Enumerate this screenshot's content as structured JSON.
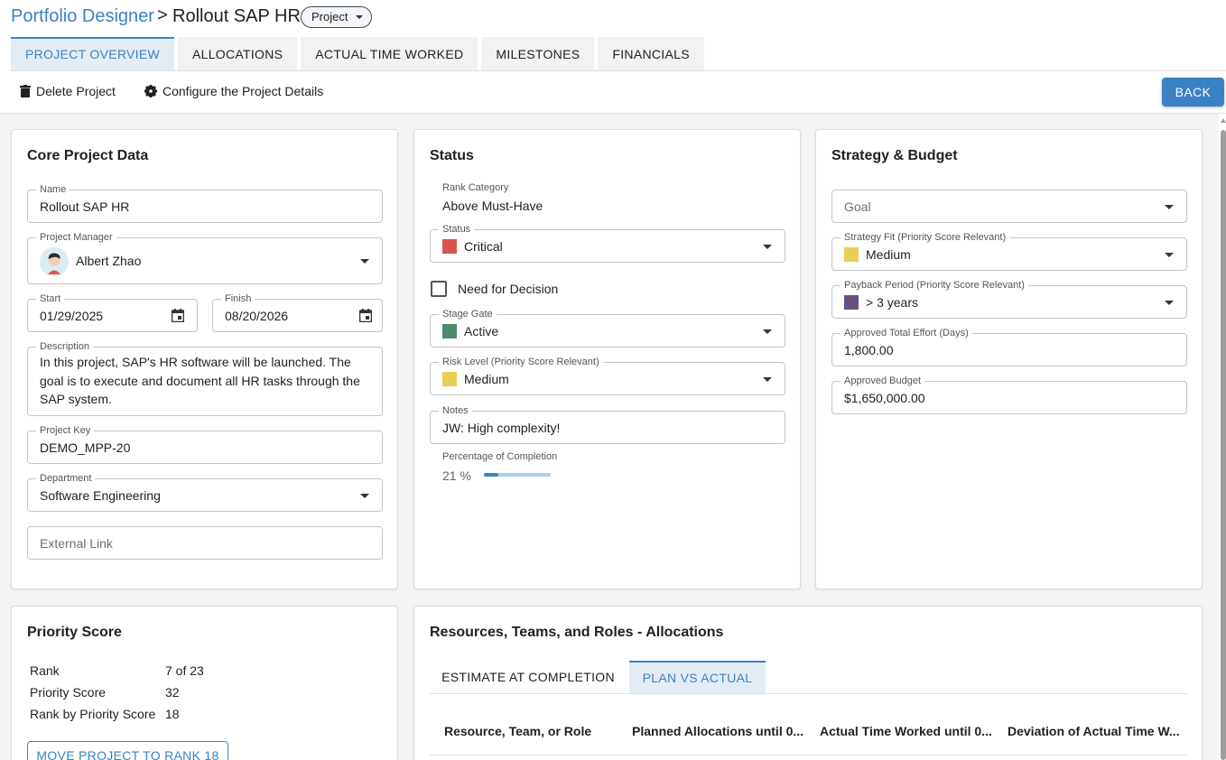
{
  "header": {
    "app_title": "Portfolio Designer",
    "separator": ">",
    "project_title": "Rollout SAP HR",
    "type_chip": "Project"
  },
  "tabs": [
    {
      "label": "PROJECT OVERVIEW",
      "active": true
    },
    {
      "label": "ALLOCATIONS",
      "active": false
    },
    {
      "label": "ACTUAL TIME WORKED",
      "active": false
    },
    {
      "label": "MILESTONES",
      "active": false
    },
    {
      "label": "FINANCIALS",
      "active": false
    }
  ],
  "toolbar": {
    "delete_label": "Delete Project",
    "configure_label": "Configure the Project Details",
    "back_label": "BACK"
  },
  "core": {
    "title": "Core Project Data",
    "name_label": "Name",
    "name_value": "Rollout SAP HR",
    "pm_label": "Project Manager",
    "pm_value": "Albert Zhao",
    "start_label": "Start",
    "start_value": "01/29/2025",
    "finish_label": "Finish",
    "finish_value": "08/20/2026",
    "description_label": "Description",
    "description_value": "In this project, SAP's HR software will be launched. The goal is to execute and document all HR tasks through the SAP system.",
    "key_label": "Project Key",
    "key_value": "DEMO_MPP-20",
    "dept_label": "Department",
    "dept_value": "Software Engineering",
    "link_placeholder": "External Link"
  },
  "status": {
    "title": "Status",
    "rank_category_label": "Rank Category",
    "rank_category_value": "Above Must-Have",
    "status_label": "Status",
    "status_value": "Critical",
    "status_color": "#d9534f",
    "need_decision_label": "Need for Decision",
    "need_decision_checked": false,
    "stage_gate_label": "Stage Gate",
    "stage_gate_value": "Active",
    "stage_gate_color": "#4e8a6e",
    "risk_label": "Risk Level (Priority Score Relevant)",
    "risk_value": "Medium",
    "risk_color": "#e8cf55",
    "notes_label": "Notes",
    "notes_value": "JW: High complexity!",
    "completion_label": "Percentage of Completion",
    "completion_text": "21 %",
    "completion_percent": 21
  },
  "strategy": {
    "title": "Strategy & Budget",
    "goal_placeholder": "Goal",
    "fit_label": "Strategy Fit (Priority Score Relevant)",
    "fit_value": "Medium",
    "fit_color": "#e8cf55",
    "payback_label": "Payback Period (Priority Score Relevant)",
    "payback_value": "> 3 years",
    "payback_color": "#6a5080",
    "effort_label": "Approved Total Effort (Days)",
    "effort_value": "1,800.00",
    "budget_label": "Approved Budget",
    "budget_value": "$1,650,000.00"
  },
  "priority": {
    "title": "Priority Score",
    "rows": [
      {
        "label": "Rank",
        "value": "7 of 23"
      },
      {
        "label": "Priority Score",
        "value": "32"
      },
      {
        "label": "Rank by Priority Score",
        "value": "18"
      }
    ],
    "move_button": "MOVE PROJECT TO RANK 18"
  },
  "resources": {
    "title": "Resources, Teams, and Roles - Allocations",
    "subtabs": [
      {
        "label": "ESTIMATE AT COMPLETION",
        "active": false
      },
      {
        "label": "PLAN VS ACTUAL",
        "active": true
      }
    ],
    "columns": [
      "Resource, Team, or Role",
      "Planned Allocations until 0...",
      "Actual Time Worked until 0...",
      "Deviation of Actual Time W..."
    ]
  },
  "colors": {
    "accent": "#3a82c4",
    "active_tab_bg": "#e3ecf5"
  },
  "icons": {
    "delete": "trash-icon",
    "configure": "gear-icon",
    "calendar": "calendar-icon",
    "dropdown": "chevron-down-icon"
  }
}
